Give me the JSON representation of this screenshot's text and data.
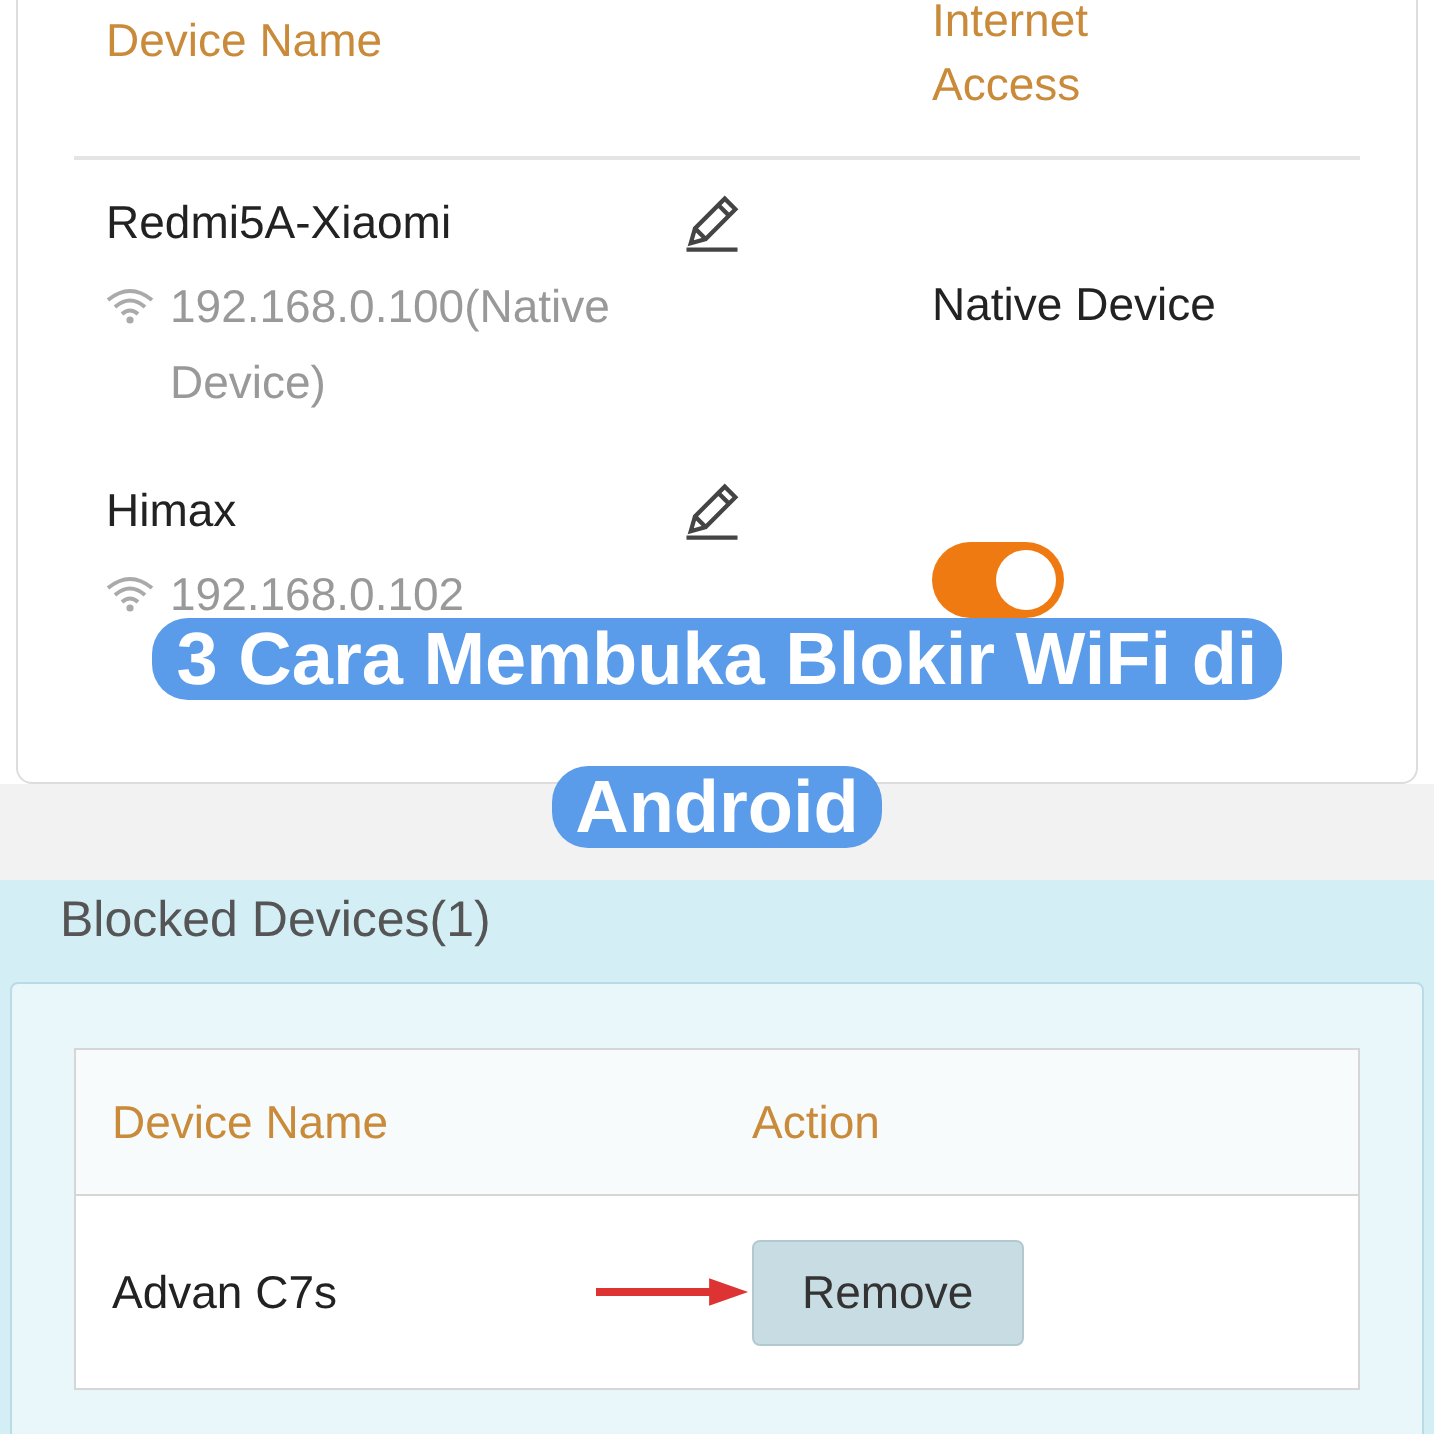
{
  "devices_table": {
    "columns": [
      "Device Name",
      "Internet Access"
    ],
    "rows": [
      {
        "name": "Redmi5A-Xiaomi",
        "ip": "192.168.0.100(Native Device)",
        "access": {
          "kind": "text",
          "text": "Native Device"
        }
      },
      {
        "name": "Himax",
        "ip": "192.168.0.102",
        "access": {
          "kind": "toggle",
          "on": true
        }
      }
    ]
  },
  "banner": {
    "title": "3 Cara Membuka Blokir WiFi di Android"
  },
  "blocked": {
    "title": "Blocked Devices(1)",
    "columns": [
      "Device Name",
      "Action"
    ],
    "rows": [
      {
        "name": "Advan C7s",
        "action": "Remove"
      }
    ]
  }
}
